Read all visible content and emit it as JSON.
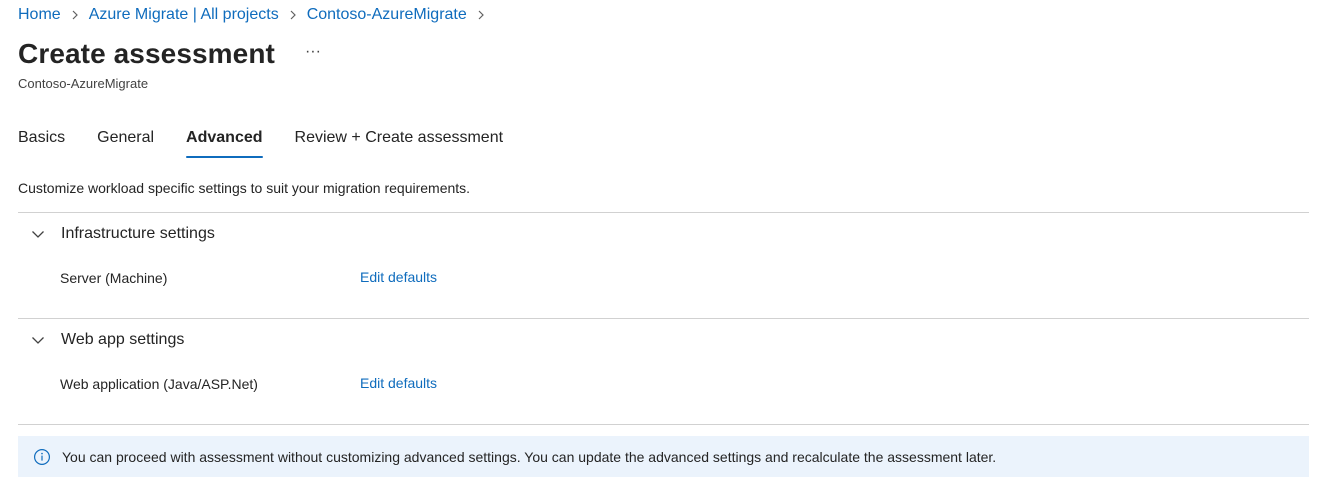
{
  "colors": {
    "accent": "#0f6cbd",
    "divider": "#d1d1d1",
    "info_background": "#ebf3fc",
    "text": "#242424"
  },
  "breadcrumb": {
    "items": [
      {
        "label": "Home",
        "icon_after": "chevron-right-icon"
      },
      {
        "label": "Azure Migrate | All projects",
        "icon_after": "chevron-right-icon"
      },
      {
        "label": "Contoso-AzureMigrate",
        "icon_after": "chevron-right-icon"
      }
    ]
  },
  "header": {
    "title": "Create assessment",
    "more_icon": "more-horizontal-icon",
    "more_label": "···",
    "subtitle": "Contoso-AzureMigrate"
  },
  "tabs": [
    {
      "label": "Basics",
      "active": false
    },
    {
      "label": "General",
      "active": false
    },
    {
      "label": "Advanced",
      "active": true
    },
    {
      "label": "Review + Create assessment",
      "active": false
    }
  ],
  "main": {
    "description": "Customize workload specific settings to suit your migration requirements.",
    "sections": [
      {
        "title": "Infrastructure settings",
        "icon": "chevron-down-icon",
        "expanded": true,
        "row": {
          "label": "Server (Machine)",
          "action": "Edit defaults"
        }
      },
      {
        "title": "Web app settings",
        "icon": "chevron-down-icon",
        "expanded": true,
        "row": {
          "label": "Web application (Java/ASP.Net)",
          "action": "Edit defaults"
        }
      }
    ],
    "info": {
      "icon": "info-icon",
      "text": "You can proceed with assessment without customizing advanced settings. You can update the advanced settings and recalculate the assessment later."
    }
  }
}
